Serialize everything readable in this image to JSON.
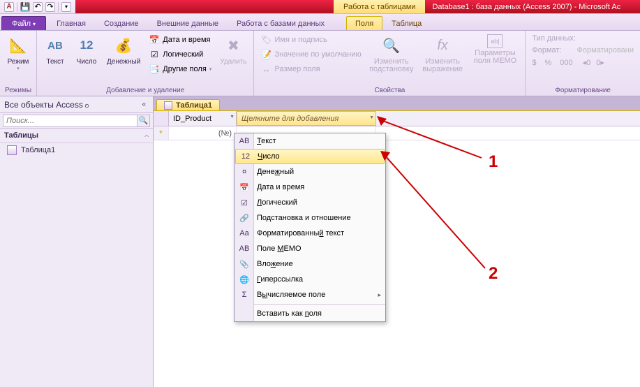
{
  "title": {
    "context": "Работа с таблицами",
    "app": "Database1 : база данных (Access 2007) - Microsoft Ac"
  },
  "tabs": {
    "file": "Файл",
    "home": "Главная",
    "create": "Создание",
    "external": "Внешние данные",
    "dbtools": "Работа с базами данных",
    "fields": "Поля",
    "table": "Таблица"
  },
  "ribbon": {
    "views_group": "Режимы",
    "view": "Режим",
    "addremove_group": "Добавление и удаление",
    "text": "Текст",
    "number": "Число",
    "currency": "Денежный",
    "datetime": "Дата и время",
    "yesno": "Логический",
    "morefields": "Другие поля",
    "delete": "Удалить",
    "props_group": "Свойства",
    "name_caption": "Имя и подпись",
    "default": "Значение по умолчанию",
    "size": "Размер поля",
    "lookup": "Изменить подстановку",
    "expr": "Изменить выражение",
    "memo": "Параметры поля MEMO",
    "format_group": "Форматирование",
    "datatype": "Тип данных:",
    "format": "Формат:",
    "formatting": "Форматировани",
    "currency_sym": "$"
  },
  "nav": {
    "header": "Все объекты Access",
    "search_ph": "Поиск...",
    "group": "Таблицы",
    "item1": "Таблица1"
  },
  "doc": {
    "tab": "Таблица1",
    "col1": "ID_Product",
    "addcol": "Щелкните для добавления",
    "newrow": "*",
    "newval": "(№)"
  },
  "menu": {
    "items": [
      {
        "icon": "AB",
        "label": "Текст",
        "u": 0
      },
      {
        "icon": "12",
        "label": "Число",
        "u": 0,
        "sel": true
      },
      {
        "icon": "¤",
        "label": "Денежный",
        "u": 4
      },
      {
        "icon": "📅",
        "label": "Дата и время",
        "u": 0
      },
      {
        "icon": "☑",
        "label": "Логический",
        "u": 0
      },
      {
        "icon": "🔗",
        "label": "Подстановка и отношение",
        "u": 2
      },
      {
        "icon": "Aa",
        "label": "Форматированный текст",
        "u": 14
      },
      {
        "icon": "AB",
        "label": "Поле МЕМО",
        "u": 5
      },
      {
        "icon": "📎",
        "label": "Вложение",
        "u": 3
      },
      {
        "icon": "🌐",
        "label": "Гиперссылка",
        "u": 0
      },
      {
        "icon": "Σ",
        "label": "Вычисляемое поле",
        "u": 1,
        "sub": true
      },
      {
        "sep": true
      },
      {
        "icon": "",
        "label": "Вставить как поля",
        "u": 13
      }
    ]
  },
  "callouts": {
    "a": "1",
    "b": "2"
  }
}
